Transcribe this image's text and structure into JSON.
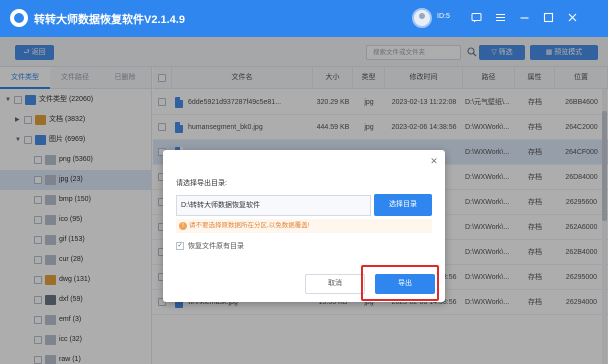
{
  "app": {
    "title": "转转大师数据恢复软件V2.1.4.9",
    "user_id": "ID:5"
  },
  "colors": {
    "brand": "#2f86ee",
    "highlight": "#e02a2a",
    "warning": "#e0883a"
  },
  "titlebar_icons": [
    "message-icon",
    "menu-icon",
    "minimize-icon",
    "maximize-icon",
    "close-icon"
  ],
  "toolbar": {
    "back_label": "返回",
    "search_placeholder": "搜索文件或文件夹",
    "filter_label": "筛选",
    "preview_label": "预览模式"
  },
  "sidebar": {
    "tabs": [
      "文件类型",
      "文件路径",
      "已删除"
    ],
    "tree": [
      {
        "label": "文件类型 (22060)",
        "level": 0,
        "arrow": "▼",
        "icon": "folder-icon",
        "color": "#4a90ea"
      },
      {
        "label": "文档 (3832)",
        "level": 1,
        "arrow": "▶",
        "icon": "document-icon",
        "color": "#e8a33c"
      },
      {
        "label": "图片 (6969)",
        "level": 1,
        "arrow": "▼",
        "icon": "image-icon",
        "color": "#4a90ea"
      },
      {
        "label": "png (5360)",
        "level": 2,
        "arrow": "",
        "icon": "png-icon",
        "color": "#b9c3d0"
      },
      {
        "label": "jpg (23)",
        "level": 2,
        "arrow": "",
        "icon": "jpg-icon",
        "color": "#b9c3d0",
        "selected": true
      },
      {
        "label": "bmp (150)",
        "level": 2,
        "arrow": "",
        "icon": "bmp-icon",
        "color": "#b9c3d0"
      },
      {
        "label": "ico (95)",
        "level": 2,
        "arrow": "",
        "icon": "ico-icon",
        "color": "#b9c3d0"
      },
      {
        "label": "gif (153)",
        "level": 2,
        "arrow": "",
        "icon": "gif-icon",
        "color": "#b9c3d0"
      },
      {
        "label": "cur (28)",
        "level": 2,
        "arrow": "",
        "icon": "cur-icon",
        "color": "#b9c3d0"
      },
      {
        "label": "dwg (131)",
        "level": 2,
        "arrow": "",
        "icon": "dwg-icon",
        "color": "#e8a33c"
      },
      {
        "label": "dxf (59)",
        "level": 2,
        "arrow": "",
        "icon": "dxf-icon",
        "color": "#6b7685"
      },
      {
        "label": "emf (3)",
        "level": 2,
        "arrow": "",
        "icon": "emf-icon",
        "color": "#b9c3d0"
      },
      {
        "label": "icc (32)",
        "level": 2,
        "arrow": "",
        "icon": "icc-icon",
        "color": "#b9c3d0"
      },
      {
        "label": "raw (1)",
        "level": 2,
        "arrow": "",
        "icon": "raw-icon",
        "color": "#b9c3d0"
      }
    ]
  },
  "table": {
    "columns": [
      "文件名",
      "大小",
      "类型",
      "修改时间",
      "路径",
      "属性",
      "位置"
    ],
    "rows": [
      {
        "name": "6dde5921d937287f49c5e81...",
        "size": "320.29 KB",
        "type": "jpg",
        "time": "2023-02-13 11:22:08",
        "path": "D:\\元气壁纸\\...",
        "attr": "存档",
        "pos": "26BB4600"
      },
      {
        "name": "humansegment_bk0.jpg",
        "size": "444.59 KB",
        "type": "jpg",
        "time": "2023-02-06 14:38:56",
        "path": "D:\\WXWork\\...",
        "attr": "存档",
        "pos": "264C2000"
      },
      {
        "name": "",
        "size": "",
        "type": "",
        "time": "",
        "path": "D:\\WXWork\\...",
        "attr": "存档",
        "pos": "264CF000",
        "selected": true
      },
      {
        "name": "",
        "size": "",
        "type": "",
        "time": "",
        "path": "D:\\WXWork\\...",
        "attr": "存档",
        "pos": "26D84000"
      },
      {
        "name": "",
        "size": "",
        "type": "",
        "time": "",
        "path": "D:\\WXWork\\...",
        "attr": "存档",
        "pos": "26295600"
      },
      {
        "name": "",
        "size": "",
        "type": "",
        "time": "",
        "path": "D:\\WXWork\\...",
        "attr": "存档",
        "pos": "262A6000"
      },
      {
        "name": "",
        "size": "",
        "type": "",
        "time": "",
        "path": "D:\\WXWork\\...",
        "attr": "存档",
        "pos": "262B4000"
      },
      {
        "name": "teeth_mask.jpg",
        "size": "4.65 KB",
        "type": "jpg",
        "time": "2023-02-06 14:38:56",
        "path": "D:\\WXWork\\...",
        "attr": "存档",
        "pos": "26295000"
      },
      {
        "name": "wrinklemask.jpg",
        "size": "15.55 KB",
        "type": "jpg",
        "time": "2023-02-06 14:38:56",
        "path": "D:\\WXWork\\...",
        "attr": "存档",
        "pos": "26294000"
      }
    ]
  },
  "dialog": {
    "label": "请选择导出目录:",
    "path_value": "D:\\转转大师数据恢复软件",
    "choose_label": "选择目录",
    "warning": "请不要选择原数据所在分区,以免数据覆盖!",
    "keep_structure_label": "恢复文件原有目录",
    "keep_structure_checked": true,
    "cancel_label": "取消",
    "export_label": "导出"
  }
}
